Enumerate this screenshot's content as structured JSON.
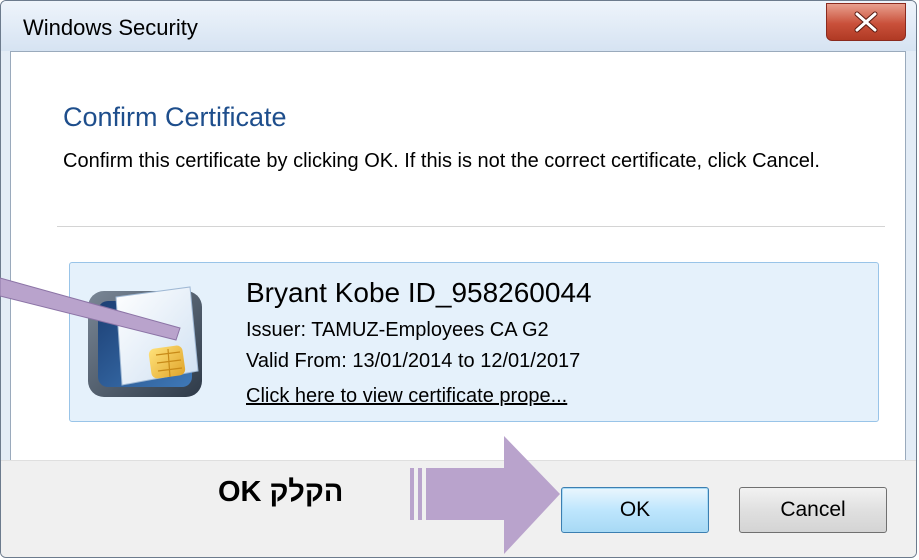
{
  "window": {
    "title": "Windows Security"
  },
  "dialog": {
    "heading": "Confirm Certificate",
    "description": "Confirm this certificate by clicking OK. If this is not the correct certificate, click Cancel."
  },
  "certificate": {
    "name": "Bryant Kobe ID_958260044",
    "issuer": "Issuer: TAMUZ-Employees CA G2",
    "valid": "Valid From: 13/01/2014 to 12/01/2017",
    "link_text": "Click here to view certificate prope...",
    "icon": "smart-card-icon"
  },
  "buttons": {
    "ok_label": "OK",
    "cancel_label": "Cancel",
    "close_icon": "close-icon"
  },
  "annotation": {
    "text": "הקלק  OK",
    "arrow_color": "#b9a3cc"
  },
  "colors": {
    "heading": "#1e4e8c",
    "close_button": "#c9503a",
    "cert_box": "#e5f1fb",
    "ok_button": "#bee6fd"
  }
}
